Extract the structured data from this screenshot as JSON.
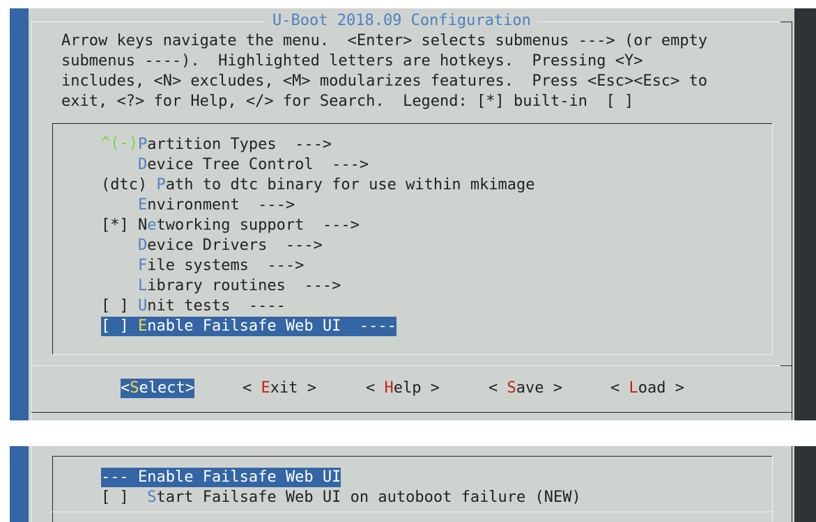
{
  "title": "U-Boot 2018.09 Configuration",
  "help_lines": [
    "Arrow keys navigate the menu.  <Enter> selects submenus ---> (or empty",
    "submenus ----).  Highlighted letters are hotkeys.  Pressing <Y>",
    "includes, <N> excludes, <M> modularizes features.  Press <Esc><Esc> to",
    "exit, <?> for Help, </> for Search.  Legend: [*] built-in  [ ]"
  ],
  "scroll_indicator": "^(-)",
  "menu_items": [
    {
      "prefix": "    ",
      "hotkey": "P",
      "rest": "artition Types  --->"
    },
    {
      "prefix": "    ",
      "hotkey": "D",
      "rest": "evice Tree Control  --->"
    },
    {
      "prefix": "(dtc) ",
      "hotkey": "P",
      "rest": "ath to dtc binary for use within mkimage"
    },
    {
      "prefix": "    ",
      "hotkey": "E",
      "rest": "nvironment  --->"
    },
    {
      "prefix": "[*] N",
      "hotkey": "e",
      "rest": "tworking support  --->"
    },
    {
      "prefix": "    ",
      "hotkey": "D",
      "rest": "evice Drivers  --->"
    },
    {
      "prefix": "    ",
      "hotkey": "F",
      "rest": "ile systems  --->"
    },
    {
      "prefix": "    ",
      "hotkey": "L",
      "rest": "ibrary routines  --->"
    },
    {
      "prefix": "[ ] ",
      "hotkey": "U",
      "rest": "nit tests  ----"
    },
    {
      "prefix": "[ ] ",
      "hotkey": "E",
      "rest": "nable Failsafe Web UI  ----"
    }
  ],
  "buttons": [
    {
      "pre": "<",
      "hotkey": "S",
      "post": "elect>"
    },
    {
      "pre": "< ",
      "hotkey": "E",
      "post": "xit >"
    },
    {
      "pre": "< ",
      "hotkey": "H",
      "post": "elp >"
    },
    {
      "pre": "< ",
      "hotkey": "S",
      "post": "ave >"
    },
    {
      "pre": "< ",
      "hotkey": "L",
      "post": "oad >"
    }
  ],
  "submenu_items": [
    {
      "prefix": "",
      "hotkey": "",
      "rest": "--- Enable Failsafe Web UI"
    },
    {
      "prefix": "[ ]  ",
      "hotkey": "S",
      "rest": "tart Failsafe Web UI on autoboot failure (NEW)"
    }
  ],
  "colors": {
    "background": "#cfd3cf",
    "left_bar": "#3465a4",
    "right_bar": "#2e3436",
    "selection": "#3465a4",
    "hotkey": "#4b82c4",
    "button_hotkey": "#c4201a",
    "selected_hotkey": "#f4d94b",
    "scroll_indicator": "#7ad63b"
  }
}
